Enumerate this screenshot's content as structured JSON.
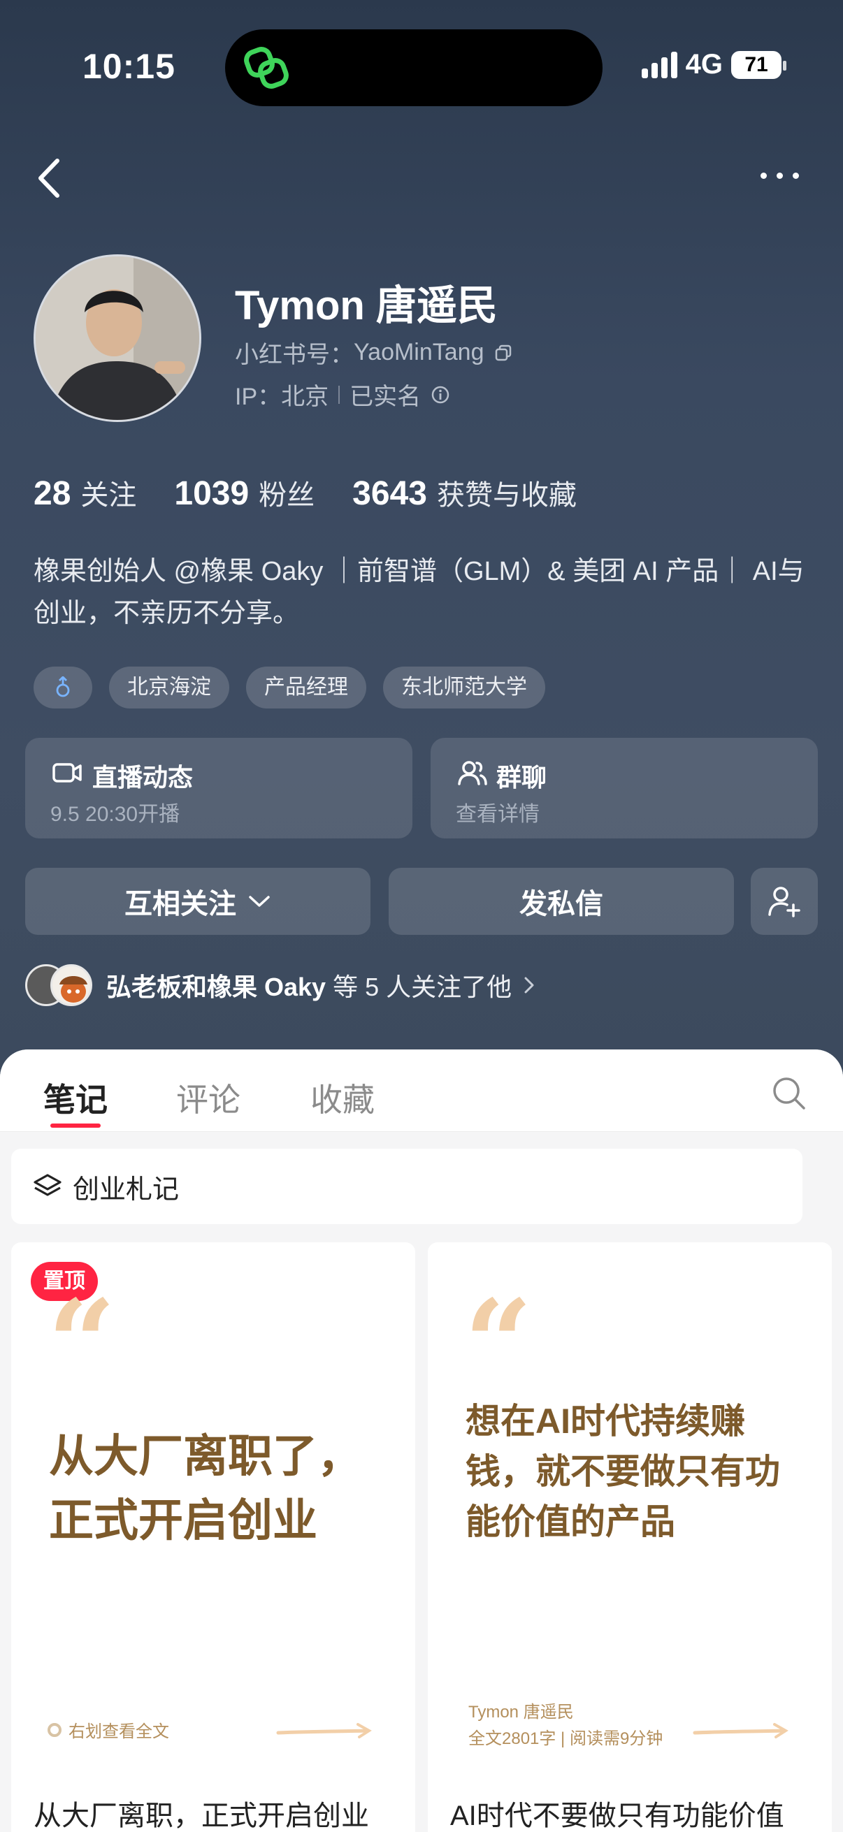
{
  "status_bar": {
    "time": "10:15",
    "network": "4G",
    "battery": "71"
  },
  "profile": {
    "name": "Tymon 唐遥民",
    "id_label": "小红书号：",
    "id_value": "YaoMinTang",
    "ip_label": "IP：",
    "ip_value": "北京",
    "verified": "已实名",
    "stats": [
      {
        "num": "28",
        "label": "关注"
      },
      {
        "num": "1039",
        "label": "粉丝"
      },
      {
        "num": "3643",
        "label": "获赞与收藏"
      }
    ],
    "bio": "橡果创始人 @橡果 Oaky ｜前智谱（GLM）& 美团 AI 产品｜ AI与创业，不亲历不分享。",
    "tags": [
      "北京海淀",
      "产品经理",
      "东北师范大学"
    ],
    "gender_icon": "male-icon"
  },
  "cards": {
    "live": {
      "title": "直播动态",
      "sub": "9.5 20:30开播"
    },
    "group": {
      "title": "群聊",
      "sub": "查看详情"
    }
  },
  "buttons": {
    "follow": "互相关注",
    "message": "发私信"
  },
  "mutual": {
    "names": "弘老板和橡果 Oaky",
    "suffix": "等 5 人关注了他"
  },
  "tabs": [
    "笔记",
    "评论",
    "收藏"
  ],
  "collection": {
    "label": "创业札记"
  },
  "notes": [
    {
      "badge": "置顶",
      "cover": "从大厂离职了，正式开启创业",
      "hint": "右划查看全文",
      "title": "从大厂离职，正式开启创业"
    },
    {
      "cover": "想在AI时代持续赚钱，就不要做只有功能价值的产品",
      "author": "Tymon 唐遥民",
      "meta": "全文2801字 | 阅读需9分钟",
      "title": "AI时代不要做只有功能价值"
    }
  ],
  "colors": {
    "accent": "#ff2442",
    "cover_text": "#7d5a2b",
    "hero_bg": "#3c4a5e"
  }
}
